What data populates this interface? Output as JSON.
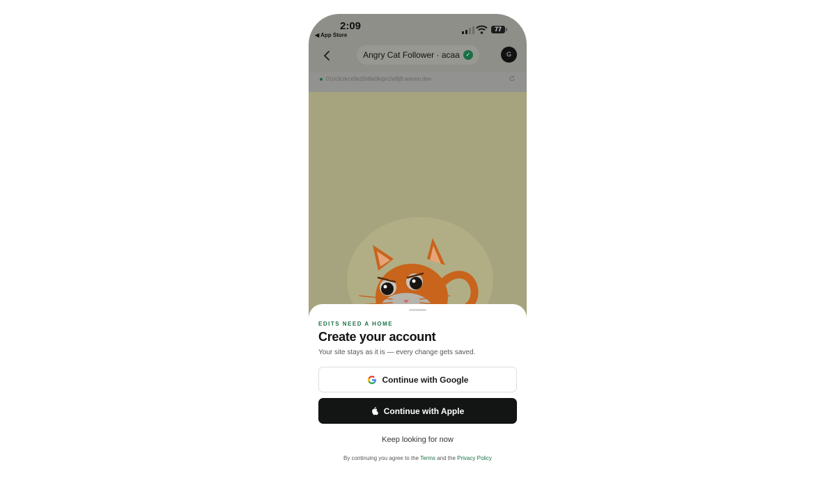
{
  "status_bar": {
    "time": "2:09",
    "back_to_app": "◀ App Store",
    "battery": "77"
  },
  "toolbar": {
    "title": "Angry Cat Follower · acaa",
    "avatar_initial": "G"
  },
  "url_bar": {
    "url": "01m3crkcx0ez5h8a0krpn2w8j9.wanno.dev"
  },
  "sheet": {
    "eyebrow": "EDITS NEED A HOME",
    "title": "Create your account",
    "subtitle": "Your site stays as it is — every change gets saved.",
    "google_button": "Continue with Google",
    "apple_button": "Continue with Apple",
    "keep_looking": "Keep looking for now",
    "legal": {
      "prefix": "By continuing you agree to the",
      "terms": "Terms",
      "and": "and the",
      "privacy": "Privacy Policy"
    }
  },
  "colors": {
    "accent_green": "#1b6f47",
    "apple_button_bg": "#131414",
    "preview_bg": "#a6a47e",
    "cat_orange": "#c8641c"
  },
  "icons": [
    "chevron-left-icon",
    "verified-check-icon",
    "reload-icon",
    "google-logo-icon",
    "apple-logo-icon",
    "signal-icon",
    "wifi-icon",
    "battery-icon"
  ]
}
